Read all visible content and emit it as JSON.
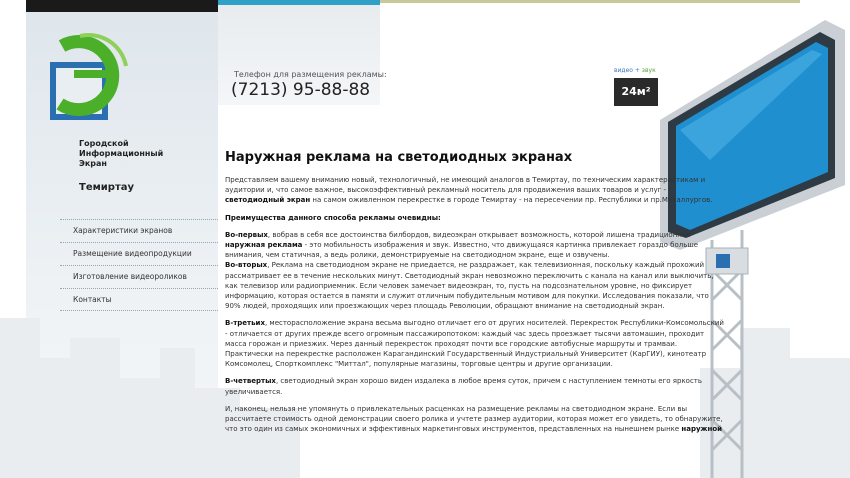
{
  "header": {
    "phone_label": "Телефон для размещения рекламы:",
    "phone": "(7213) 95-88-88"
  },
  "brand": {
    "org_name": "Городской\nИнформационный\nЭкран",
    "city": "Темиртау"
  },
  "nav": {
    "items": [
      {
        "label": "Характеристики экранов"
      },
      {
        "label": "Размещение видеопродукции"
      },
      {
        "label": "Изготовление видеороликов"
      },
      {
        "label": "Контакты"
      }
    ]
  },
  "badge": {
    "top_video": "видео",
    "top_plus": " + ",
    "top_sound": "звук",
    "size": "24м²"
  },
  "content": {
    "title": "Наружная реклама на светодиодных экранах",
    "p1a": "Представляем вашему вниманию новый, технологичный, не имеющий аналогов в Темиртау, по техническим характеристикам и аудитории и, что самое важное, высокоэффективный рекламный носитель для продвижения ваших товаров и услуг - ",
    "p1b": "светодиодный экран",
    "p1c": " на самом оживленном перекрестке в городе Темиртау - на пересечении пр. Республики и пр.Металлургов.",
    "p2": "Преимущества данного способа рекламы очевидны:",
    "p3a": "Во-первых",
    "p3b": ", вобрав в себя все достоинства билбордов, видеоэкран открывает возможность, которой лишена традиционная ",
    "p3c": "наружная реклама",
    "p3d": " - это мобильность изображения и звук. Известно, что движущаяся картинка привлекает гораздо больше внимания, чем статичная, а ведь ролики, демонстрируемые на светодиодном экране, еще и озвучены.",
    "p4a": "Во-вторых",
    "p4b": ", Реклама на светодиодном экране не приедается, не раздражает, как телевизионная, поскольку каждый прохожий рассматривает ее в течение нескольких минут. Светодиодный экран невозможно переключить с канала на канал или выключить, как телевизор или радиоприемник. Если человек замечает видеоэкран, то, пусть на подсознательном уровне, но фиксирует информацию, которая остается в памяти и служит отличным побудительным мотивом для покупки. Исследования показали, что 90% людей, проходящих или проезжающих через площадь Революции, обращают внимание на светодиодный экран.",
    "p5a": "В-третьих",
    "p5b": ", месторасположение экрана весьма выгодно отличает его от других носителей. Перекресток Республики-Комсомольский - отличается от других прежде всего огромным пассажиропотоком: каждый час здесь проезжает тысячи автомашин, проходит масса горожан и приезжих. Через данный перекресток проходят почти все городские автобусные маршруты и трамваи. Практически на перекрестке расположен Карагандинский Государственный Индустриальный Университет (КарГИУ), кинотеатр Комсомолец, Спорткомплекс \"Миттал\", популярные магазины, торговые центры и другие организации.",
    "p6a": "В-четвертых",
    "p6b": ", светодиодный экран хорошо виден издалека в любое время суток, причем с наступлением темноты его яркость увеличивается.",
    "p7a": "И, наконец, нельзя не упомянуть о привлекательных расценках на размещение рекламы на светодиодном экране. Если вы рассчитаете стоимость одной демонстрации своего ролика и учтете размер аудитории, которая может его увидеть, то обнаружите, что это один из самых экономичных и эффективных маркетинговых инструментов, представленных на нынешнем рынке ",
    "p7b": "наружной"
  },
  "colors": {
    "accent_blue": "#2fa0c8",
    "logo_green": "#4caf2a",
    "screen_blue": "#1f8fd0"
  }
}
